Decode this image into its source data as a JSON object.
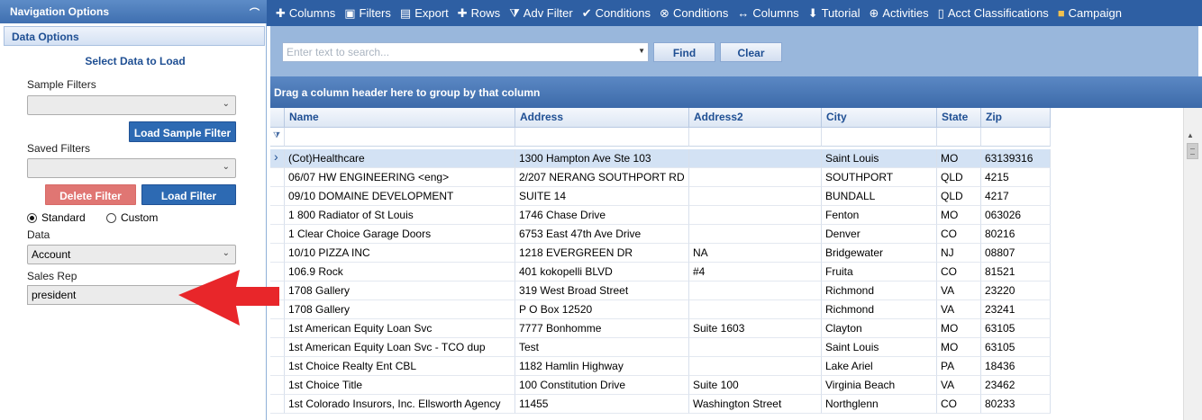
{
  "nav": {
    "header": "Navigation Options",
    "section": "Data Options",
    "select_title": "Select Data to Load",
    "sample_filters_label": "Sample Filters",
    "sample_filters_value": "",
    "load_sample_filter": "Load Sample Filter",
    "saved_filters_label": "Saved Filters",
    "saved_filters_value": "",
    "delete_filter": "Delete Filter",
    "load_filter": "Load Filter",
    "radio_standard": "Standard",
    "radio_custom": "Custom",
    "radio_selected": "Standard",
    "data_label": "Data",
    "data_value": "Account",
    "sales_rep_label": "Sales Rep",
    "sales_rep_value": "president"
  },
  "toolbar": [
    {
      "label": "Columns",
      "icon": "plus-icon"
    },
    {
      "label": "Filters",
      "icon": "save-icon"
    },
    {
      "label": "Export",
      "icon": "export-icon"
    },
    {
      "label": "Rows",
      "icon": "plus-icon"
    },
    {
      "label": "Adv Filter",
      "icon": "funnel-icon"
    },
    {
      "label": "Conditions",
      "icon": "check-icon"
    },
    {
      "label": "Conditions",
      "icon": "circle-x-icon"
    },
    {
      "label": "Columns",
      "icon": "arrows-lr-icon"
    },
    {
      "label": "Tutorial",
      "icon": "arrow-down-icon"
    },
    {
      "label": "Activities",
      "icon": "circle-plus-icon"
    },
    {
      "label": "Acct Classifications",
      "icon": "document-icon"
    },
    {
      "label": "Campaign",
      "icon": "briefcase-icon"
    }
  ],
  "search": {
    "placeholder": "Enter text to search...",
    "find": "Find",
    "clear": "Clear"
  },
  "group_panel": "Drag a column header here to group by that column",
  "grid": {
    "columns": [
      "Name",
      "Address",
      "Address2",
      "City",
      "State",
      "Zip"
    ],
    "rows": [
      [
        "(Cot)Healthcare",
        "1300 Hampton Ave Ste 103",
        "",
        "Saint Louis",
        "MO",
        "63139316"
      ],
      [
        "06/07 HW ENGINEERING <eng>",
        "2/207 NERANG SOUTHPORT RD",
        "",
        "SOUTHPORT",
        "QLD",
        "4215"
      ],
      [
        "09/10 DOMAINE DEVELOPMENT",
        "SUITE 14",
        "",
        "BUNDALL",
        "QLD",
        "4217"
      ],
      [
        "1 800 Radiator of St Louis",
        "1746 Chase Drive",
        "",
        "Fenton",
        "MO",
        "063026"
      ],
      [
        "1 Clear Choice Garage Doors",
        "6753 East 47th Ave Drive",
        "",
        "Denver",
        "CO",
        "80216"
      ],
      [
        "10/10 PIZZA INC",
        "1218 EVERGREEN DR",
        "NA",
        "Bridgewater",
        "NJ",
        "08807"
      ],
      [
        "106.9 Rock",
        "401 kokopelli BLVD",
        "#4",
        "Fruita",
        "CO",
        "81521"
      ],
      [
        "1708 Gallery",
        "319 West Broad Street",
        "",
        "Richmond",
        "VA",
        "23220"
      ],
      [
        "1708 Gallery",
        "P O  Box 12520",
        "",
        "Richmond",
        "VA",
        "23241"
      ],
      [
        "1st American Equity Loan Svc",
        "7777 Bonhomme",
        "Suite 1603",
        "Clayton",
        "MO",
        "63105"
      ],
      [
        "1st American Equity Loan Svc - TCO dup",
        "Test",
        "",
        "Saint Louis",
        "MO",
        "63105"
      ],
      [
        "1st Choice Realty Ent CBL",
        "1182 Hamlin Highway",
        "",
        "Lake Ariel",
        "PA",
        "18436"
      ],
      [
        "1st Choice Title",
        "100 Constitution Drive",
        "Suite 100",
        "Virginia Beach",
        "VA",
        "23462"
      ],
      [
        "1st Colorado Insurors, Inc. Ellsworth Agency",
        "11455",
        "Washington Street",
        "Northglenn",
        "CO",
        "80233"
      ]
    ]
  },
  "colors": {
    "toolbar_bg": "#2e5fa3",
    "accent_blue": "#2d6ab3",
    "delete_red": "#e07673",
    "arrow_red": "#e8262a",
    "selected_row": "#d3e2f4"
  }
}
